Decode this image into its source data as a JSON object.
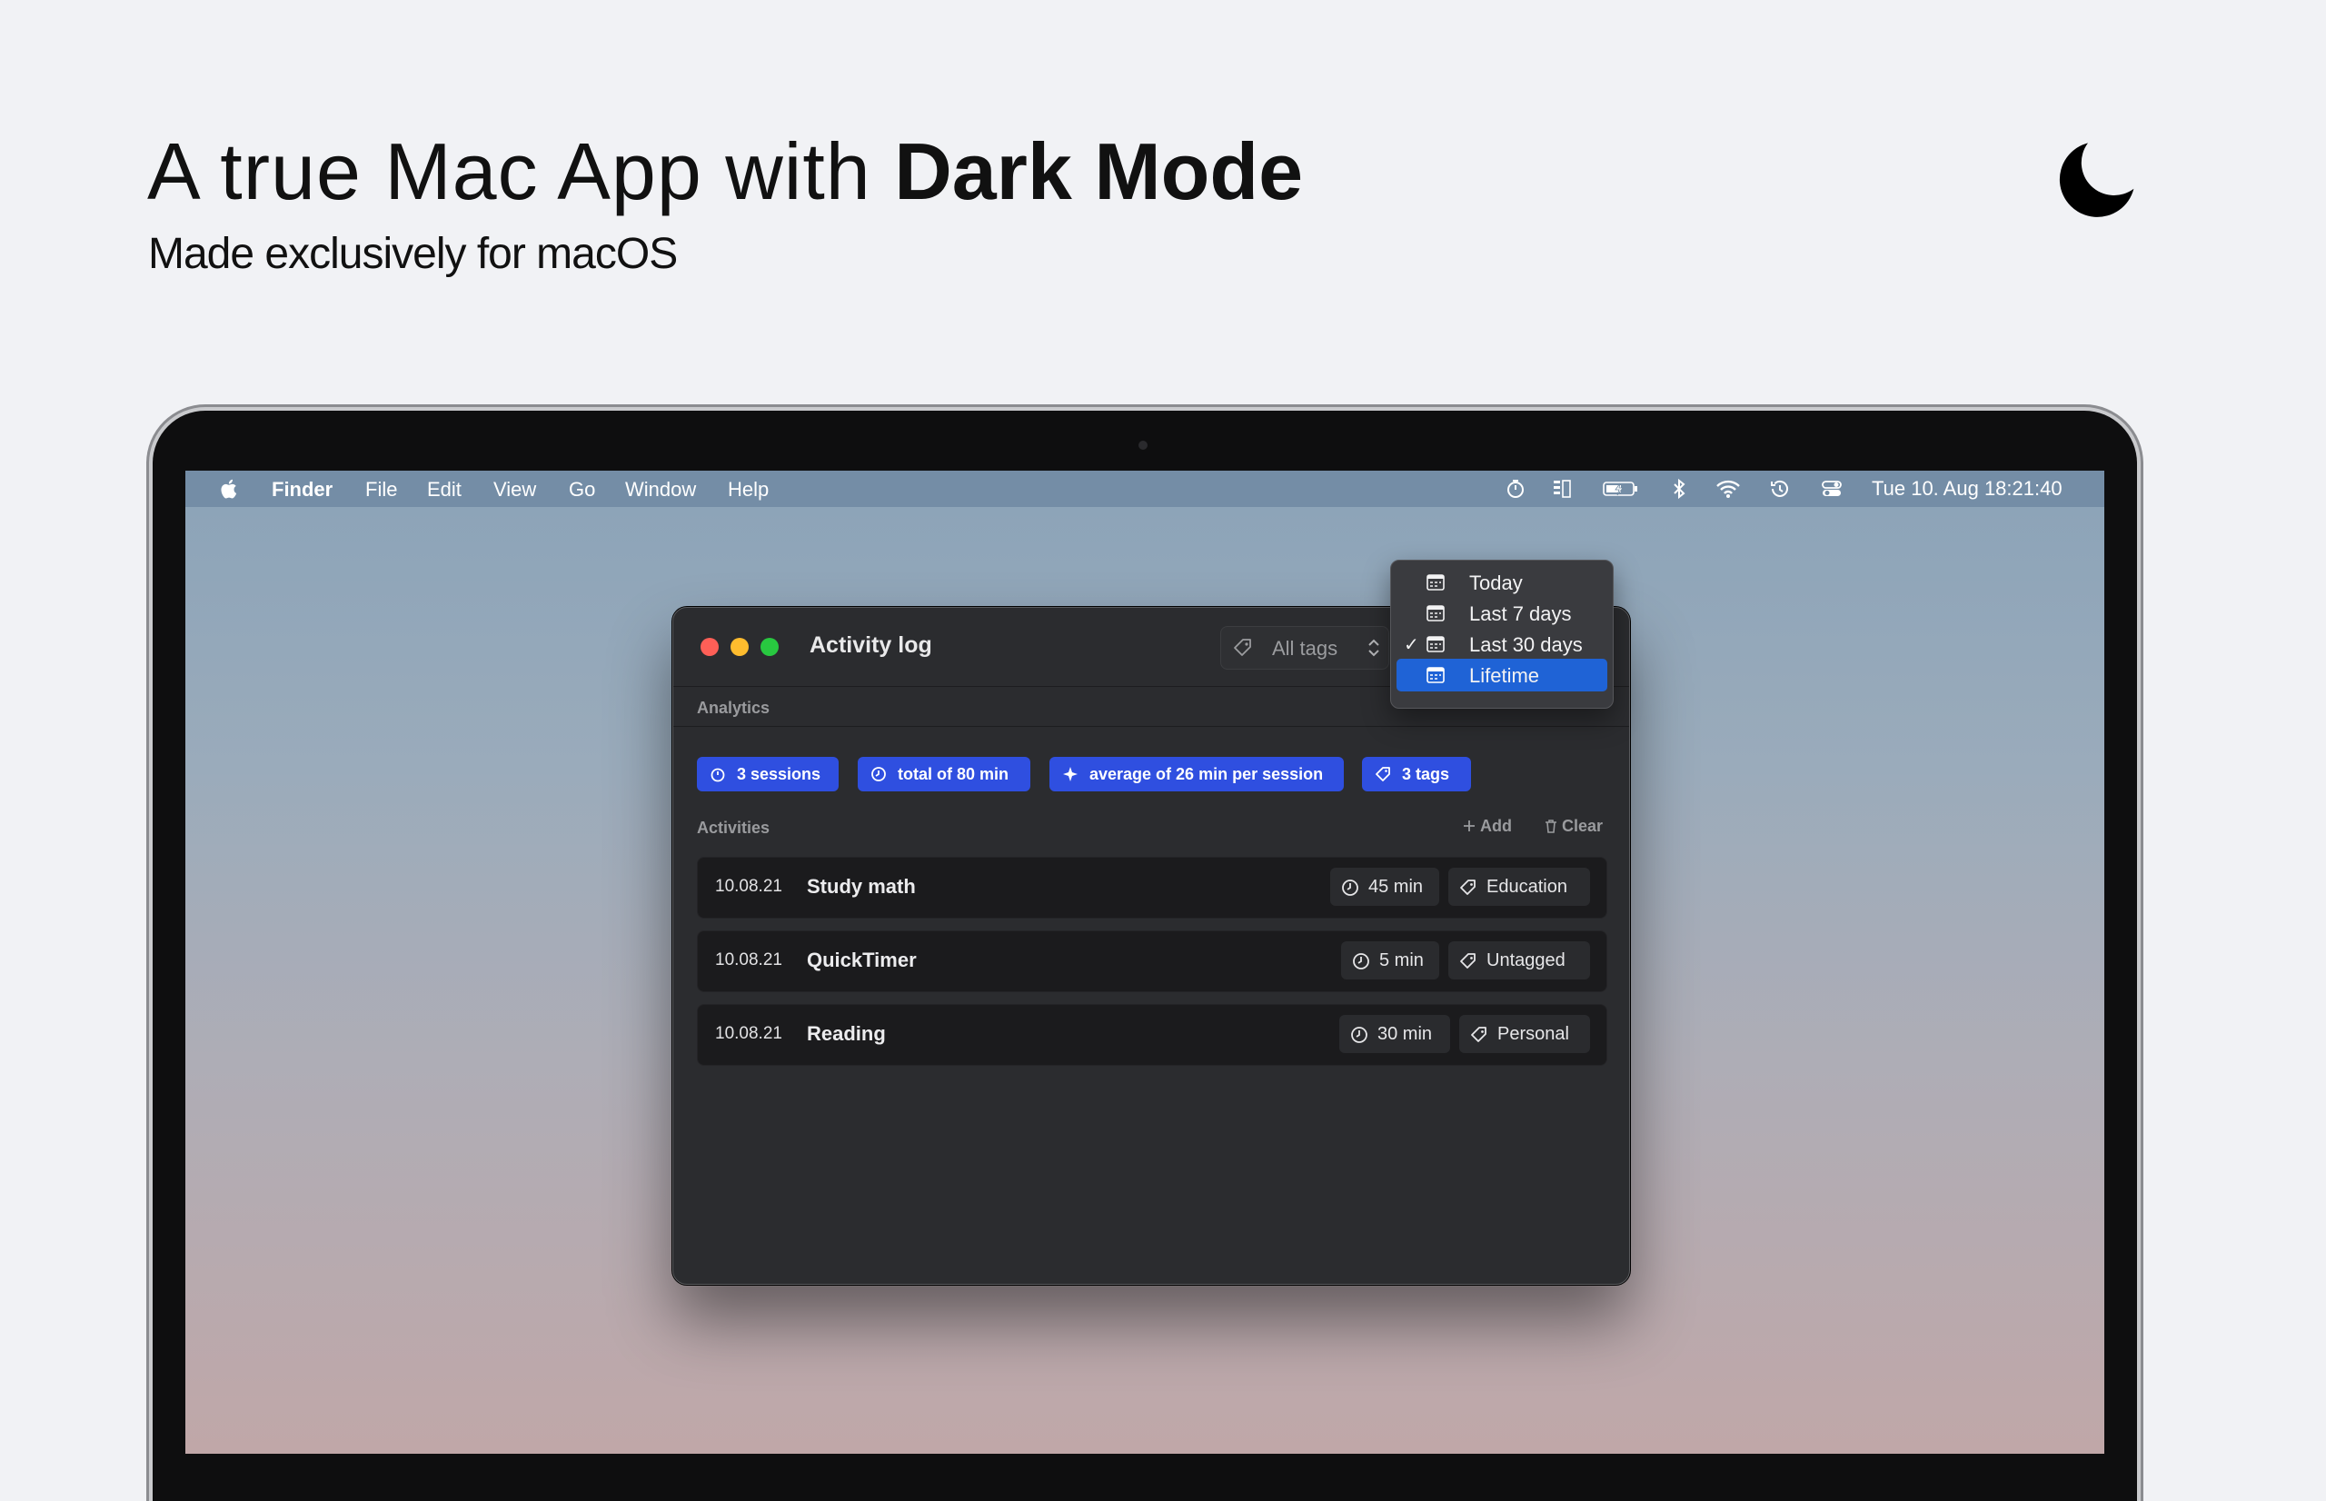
{
  "hero": {
    "headline_light": "A true Mac App with ",
    "headline_bold": "Dark Mode",
    "subheadline": "Made exclusively for macOS"
  },
  "menubar": {
    "app": "Finder",
    "items": [
      "File",
      "Edit",
      "View",
      "Go",
      "Window",
      "Help"
    ],
    "status_icons": [
      "timer-icon",
      "stage-icon",
      "battery-charging-icon",
      "bluetooth-icon",
      "wifi-icon",
      "time-machine-icon",
      "control-center-icon"
    ],
    "clock": "Tue 10. Aug  18:21:40"
  },
  "window": {
    "title": "Activity log",
    "tag_filter": "All tags",
    "analytics_label": "Analytics",
    "chips": [
      {
        "icon": "timer-icon",
        "label": "3 sessions"
      },
      {
        "icon": "clock-icon",
        "label": "total of 80 min"
      },
      {
        "icon": "sparkle-icon",
        "label": "average of 26 min per session"
      },
      {
        "icon": "tag-icon",
        "label": "3 tags"
      }
    ],
    "activities_label": "Activities",
    "add_label": "Add",
    "clear_label": "Clear",
    "activities": [
      {
        "date": "10.08.21",
        "name": "Study math",
        "duration": "45 min",
        "tag": "Education"
      },
      {
        "date": "10.08.21",
        "name": "QuickTimer",
        "duration": "5 min",
        "tag": "Untagged"
      },
      {
        "date": "10.08.21",
        "name": "Reading",
        "duration": "30 min",
        "tag": "Personal"
      }
    ]
  },
  "range_menu": {
    "items": [
      {
        "label": "Today",
        "checked": false,
        "selected": false
      },
      {
        "label": "Last 7 days",
        "checked": false,
        "selected": false
      },
      {
        "label": "Last 30 days",
        "checked": true,
        "selected": false
      },
      {
        "label": "Lifetime",
        "checked": false,
        "selected": true
      }
    ],
    "check_glyph": "✓"
  },
  "colors": {
    "chip": "#2f4fe0",
    "menu_selection": "#1f63d6",
    "close": "#fe5f57",
    "minimize": "#febc2e",
    "zoom": "#28c840"
  }
}
